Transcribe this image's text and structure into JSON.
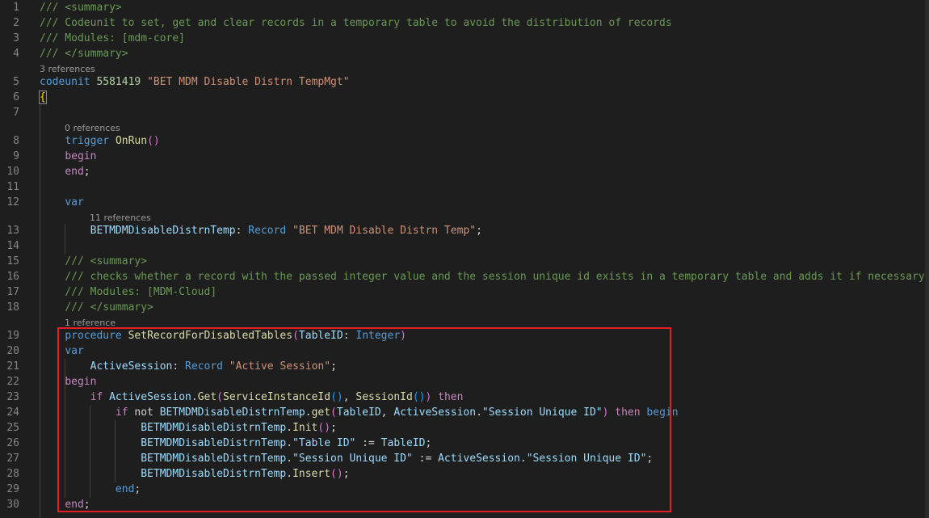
{
  "lines": [
    {
      "n": "1",
      "tokens": [
        {
          "c": "c",
          "t": "/// <summary>"
        }
      ]
    },
    {
      "n": "2",
      "tokens": [
        {
          "c": "c",
          "t": "/// Codeunit to set, get and clear records in a temporary table to avoid the distribution of records"
        }
      ]
    },
    {
      "n": "3",
      "tokens": [
        {
          "c": "c",
          "t": "/// Modules: [mdm-core]"
        }
      ]
    },
    {
      "n": "4",
      "tokens": [
        {
          "c": "c",
          "t": "/// </summary>"
        }
      ]
    },
    {
      "n": "5",
      "tokens": [
        {
          "c": "k",
          "t": "codeunit "
        },
        {
          "c": "n",
          "t": "5581419 "
        },
        {
          "c": "s",
          "t": "\"BET MDM Disable Distrn TempMgt\""
        }
      ]
    },
    {
      "n": "6",
      "tokens": [
        {
          "c": "b1 bm",
          "t": "{"
        }
      ]
    },
    {
      "n": "7",
      "tokens": []
    },
    {
      "n": "8",
      "tokens": [
        {
          "c": "t",
          "t": "    "
        },
        {
          "c": "k",
          "t": "trigger "
        },
        {
          "c": "f",
          "t": "OnRun"
        },
        {
          "c": "b2",
          "t": "()"
        }
      ]
    },
    {
      "n": "9",
      "tokens": [
        {
          "c": "t",
          "t": "    "
        },
        {
          "c": "p",
          "t": "begin"
        }
      ]
    },
    {
      "n": "10",
      "tokens": [
        {
          "c": "t",
          "t": "    "
        },
        {
          "c": "p",
          "t": "end"
        },
        {
          "c": "t",
          "t": ";"
        }
      ]
    },
    {
      "n": "11",
      "tokens": []
    },
    {
      "n": "12",
      "tokens": [
        {
          "c": "t",
          "t": "    "
        },
        {
          "c": "k",
          "t": "var"
        }
      ]
    },
    {
      "n": "13",
      "tokens": [
        {
          "c": "t",
          "t": "        "
        },
        {
          "c": "v",
          "t": "BETMDMDisableDistrnTemp"
        },
        {
          "c": "t",
          "t": ": "
        },
        {
          "c": "k",
          "t": "Record "
        },
        {
          "c": "s",
          "t": "\"BET MDM Disable Distrn Temp\""
        },
        {
          "c": "t",
          "t": ";"
        }
      ]
    },
    {
      "n": "14",
      "tokens": []
    },
    {
      "n": "15",
      "tokens": [
        {
          "c": "t",
          "t": "    "
        },
        {
          "c": "c",
          "t": "/// <summary>"
        }
      ]
    },
    {
      "n": "16",
      "tokens": [
        {
          "c": "t",
          "t": "    "
        },
        {
          "c": "c",
          "t": "/// checks whether a record with the passed integer value and the session unique id exists in a temporary table and adds it if necessary"
        }
      ]
    },
    {
      "n": "17",
      "tokens": [
        {
          "c": "t",
          "t": "    "
        },
        {
          "c": "c",
          "t": "/// Modules: [MDM-Cloud]"
        }
      ]
    },
    {
      "n": "18",
      "tokens": [
        {
          "c": "t",
          "t": "    "
        },
        {
          "c": "c",
          "t": "/// </summary>"
        }
      ]
    },
    {
      "n": "19",
      "tokens": [
        {
          "c": "t",
          "t": "    "
        },
        {
          "c": "k",
          "t": "procedure "
        },
        {
          "c": "f",
          "t": "SetRecordForDisabledTables"
        },
        {
          "c": "b2",
          "t": "("
        },
        {
          "c": "v",
          "t": "TableID"
        },
        {
          "c": "t",
          "t": ": "
        },
        {
          "c": "k",
          "t": "Integer"
        },
        {
          "c": "b2",
          "t": ")"
        }
      ]
    },
    {
      "n": "20",
      "tokens": [
        {
          "c": "t",
          "t": "    "
        },
        {
          "c": "k",
          "t": "var"
        }
      ]
    },
    {
      "n": "21",
      "tokens": [
        {
          "c": "t",
          "t": "        "
        },
        {
          "c": "v",
          "t": "ActiveSession"
        },
        {
          "c": "t",
          "t": ": "
        },
        {
          "c": "k",
          "t": "Record "
        },
        {
          "c": "s",
          "t": "\"Active Session\""
        },
        {
          "c": "t",
          "t": ";"
        }
      ]
    },
    {
      "n": "22",
      "tokens": [
        {
          "c": "t",
          "t": "    "
        },
        {
          "c": "p",
          "t": "begin"
        }
      ]
    },
    {
      "n": "23",
      "tokens": [
        {
          "c": "t",
          "t": "        "
        },
        {
          "c": "p",
          "t": "if "
        },
        {
          "c": "v",
          "t": "ActiveSession"
        },
        {
          "c": "t",
          "t": "."
        },
        {
          "c": "f",
          "t": "Get"
        },
        {
          "c": "b2",
          "t": "("
        },
        {
          "c": "f",
          "t": "ServiceInstanceId"
        },
        {
          "c": "b3",
          "t": "()"
        },
        {
          "c": "t",
          "t": ", "
        },
        {
          "c": "f",
          "t": "SessionId"
        },
        {
          "c": "b3",
          "t": "()"
        },
        {
          "c": "b2",
          "t": ")"
        },
        {
          "c": "p",
          "t": " then"
        }
      ]
    },
    {
      "n": "24",
      "tokens": [
        {
          "c": "t",
          "t": "            "
        },
        {
          "c": "p",
          "t": "if "
        },
        {
          "c": "t",
          "t": "not "
        },
        {
          "c": "v",
          "t": "BETMDMDisableDistrnTemp"
        },
        {
          "c": "t",
          "t": "."
        },
        {
          "c": "f",
          "t": "get"
        },
        {
          "c": "b2",
          "t": "("
        },
        {
          "c": "v",
          "t": "TableID"
        },
        {
          "c": "t",
          "t": ", "
        },
        {
          "c": "v",
          "t": "ActiveSession"
        },
        {
          "c": "t",
          "t": "."
        },
        {
          "c": "v",
          "t": "\"Session Unique ID\""
        },
        {
          "c": "b2",
          "t": ")"
        },
        {
          "c": "p",
          "t": " then "
        },
        {
          "c": "k",
          "t": "begin"
        }
      ]
    },
    {
      "n": "25",
      "tokens": [
        {
          "c": "t",
          "t": "                "
        },
        {
          "c": "v",
          "t": "BETMDMDisableDistrnTemp"
        },
        {
          "c": "t",
          "t": "."
        },
        {
          "c": "f",
          "t": "Init"
        },
        {
          "c": "b2",
          "t": "()"
        },
        {
          "c": "t",
          "t": ";"
        }
      ]
    },
    {
      "n": "26",
      "tokens": [
        {
          "c": "t",
          "t": "                "
        },
        {
          "c": "v",
          "t": "BETMDMDisableDistrnTemp"
        },
        {
          "c": "t",
          "t": "."
        },
        {
          "c": "v",
          "t": "\"Table ID\""
        },
        {
          "c": "t",
          "t": " := "
        },
        {
          "c": "v",
          "t": "TableID"
        },
        {
          "c": "t",
          "t": ";"
        }
      ]
    },
    {
      "n": "27",
      "tokens": [
        {
          "c": "t",
          "t": "                "
        },
        {
          "c": "v",
          "t": "BETMDMDisableDistrnTemp"
        },
        {
          "c": "t",
          "t": "."
        },
        {
          "c": "v",
          "t": "\"Session Unique ID\""
        },
        {
          "c": "t",
          "t": " := "
        },
        {
          "c": "v",
          "t": "ActiveSession"
        },
        {
          "c": "t",
          "t": "."
        },
        {
          "c": "v",
          "t": "\"Session Unique ID\""
        },
        {
          "c": "t",
          "t": ";"
        }
      ]
    },
    {
      "n": "28",
      "tokens": [
        {
          "c": "t",
          "t": "                "
        },
        {
          "c": "v",
          "t": "BETMDMDisableDistrnTemp"
        },
        {
          "c": "t",
          "t": "."
        },
        {
          "c": "f",
          "t": "Insert"
        },
        {
          "c": "b2",
          "t": "()"
        },
        {
          "c": "t",
          "t": ";"
        }
      ]
    },
    {
      "n": "29",
      "tokens": [
        {
          "c": "t",
          "t": "            "
        },
        {
          "c": "k",
          "t": "end"
        },
        {
          "c": "t",
          "t": ";"
        }
      ]
    },
    {
      "n": "30",
      "tokens": [
        {
          "c": "t",
          "t": "    "
        },
        {
          "c": "p",
          "t": "end"
        },
        {
          "c": "t",
          "t": ";"
        }
      ]
    }
  ],
  "codelens": {
    "codeunit_refs": "3 references",
    "onrun_refs": "0 references",
    "var_refs": "11 references",
    "procedure_refs": "1 reference"
  },
  "theme": {
    "background": "#1e1e1e",
    "highlight_border": "#e21f26"
  }
}
